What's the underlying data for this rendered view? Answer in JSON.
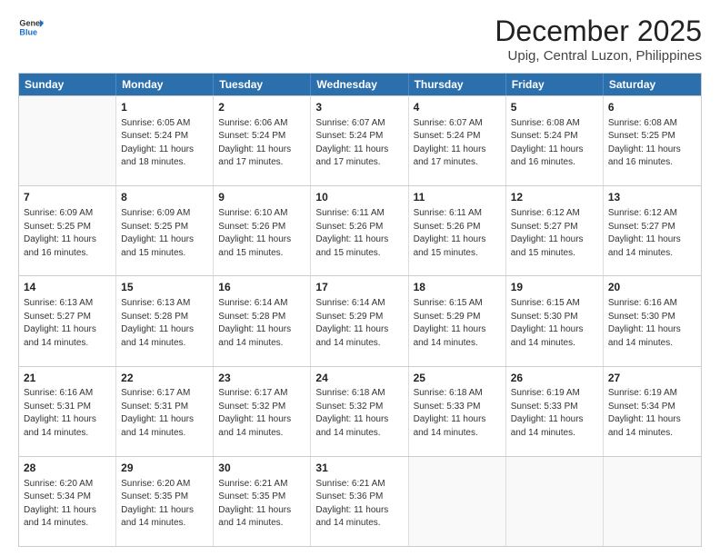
{
  "header": {
    "logo_general": "General",
    "logo_blue": "Blue",
    "title": "December 2025",
    "subtitle": "Upig, Central Luzon, Philippines"
  },
  "days": [
    "Sunday",
    "Monday",
    "Tuesday",
    "Wednesday",
    "Thursday",
    "Friday",
    "Saturday"
  ],
  "weeks": [
    [
      {
        "day": "",
        "empty": true
      },
      {
        "day": "1",
        "sunrise": "Sunrise: 6:05 AM",
        "sunset": "Sunset: 5:24 PM",
        "daylight": "Daylight: 11 hours and 18 minutes."
      },
      {
        "day": "2",
        "sunrise": "Sunrise: 6:06 AM",
        "sunset": "Sunset: 5:24 PM",
        "daylight": "Daylight: 11 hours and 17 minutes."
      },
      {
        "day": "3",
        "sunrise": "Sunrise: 6:07 AM",
        "sunset": "Sunset: 5:24 PM",
        "daylight": "Daylight: 11 hours and 17 minutes."
      },
      {
        "day": "4",
        "sunrise": "Sunrise: 6:07 AM",
        "sunset": "Sunset: 5:24 PM",
        "daylight": "Daylight: 11 hours and 17 minutes."
      },
      {
        "day": "5",
        "sunrise": "Sunrise: 6:08 AM",
        "sunset": "Sunset: 5:24 PM",
        "daylight": "Daylight: 11 hours and 16 minutes."
      },
      {
        "day": "6",
        "sunrise": "Sunrise: 6:08 AM",
        "sunset": "Sunset: 5:25 PM",
        "daylight": "Daylight: 11 hours and 16 minutes."
      }
    ],
    [
      {
        "day": "7",
        "sunrise": "Sunrise: 6:09 AM",
        "sunset": "Sunset: 5:25 PM",
        "daylight": "Daylight: 11 hours and 16 minutes."
      },
      {
        "day": "8",
        "sunrise": "Sunrise: 6:09 AM",
        "sunset": "Sunset: 5:25 PM",
        "daylight": "Daylight: 11 hours and 15 minutes."
      },
      {
        "day": "9",
        "sunrise": "Sunrise: 6:10 AM",
        "sunset": "Sunset: 5:26 PM",
        "daylight": "Daylight: 11 hours and 15 minutes."
      },
      {
        "day": "10",
        "sunrise": "Sunrise: 6:11 AM",
        "sunset": "Sunset: 5:26 PM",
        "daylight": "Daylight: 11 hours and 15 minutes."
      },
      {
        "day": "11",
        "sunrise": "Sunrise: 6:11 AM",
        "sunset": "Sunset: 5:26 PM",
        "daylight": "Daylight: 11 hours and 15 minutes."
      },
      {
        "day": "12",
        "sunrise": "Sunrise: 6:12 AM",
        "sunset": "Sunset: 5:27 PM",
        "daylight": "Daylight: 11 hours and 15 minutes."
      },
      {
        "day": "13",
        "sunrise": "Sunrise: 6:12 AM",
        "sunset": "Sunset: 5:27 PM",
        "daylight": "Daylight: 11 hours and 14 minutes."
      }
    ],
    [
      {
        "day": "14",
        "sunrise": "Sunrise: 6:13 AM",
        "sunset": "Sunset: 5:27 PM",
        "daylight": "Daylight: 11 hours and 14 minutes."
      },
      {
        "day": "15",
        "sunrise": "Sunrise: 6:13 AM",
        "sunset": "Sunset: 5:28 PM",
        "daylight": "Daylight: 11 hours and 14 minutes."
      },
      {
        "day": "16",
        "sunrise": "Sunrise: 6:14 AM",
        "sunset": "Sunset: 5:28 PM",
        "daylight": "Daylight: 11 hours and 14 minutes."
      },
      {
        "day": "17",
        "sunrise": "Sunrise: 6:14 AM",
        "sunset": "Sunset: 5:29 PM",
        "daylight": "Daylight: 11 hours and 14 minutes."
      },
      {
        "day": "18",
        "sunrise": "Sunrise: 6:15 AM",
        "sunset": "Sunset: 5:29 PM",
        "daylight": "Daylight: 11 hours and 14 minutes."
      },
      {
        "day": "19",
        "sunrise": "Sunrise: 6:15 AM",
        "sunset": "Sunset: 5:30 PM",
        "daylight": "Daylight: 11 hours and 14 minutes."
      },
      {
        "day": "20",
        "sunrise": "Sunrise: 6:16 AM",
        "sunset": "Sunset: 5:30 PM",
        "daylight": "Daylight: 11 hours and 14 minutes."
      }
    ],
    [
      {
        "day": "21",
        "sunrise": "Sunrise: 6:16 AM",
        "sunset": "Sunset: 5:31 PM",
        "daylight": "Daylight: 11 hours and 14 minutes."
      },
      {
        "day": "22",
        "sunrise": "Sunrise: 6:17 AM",
        "sunset": "Sunset: 5:31 PM",
        "daylight": "Daylight: 11 hours and 14 minutes."
      },
      {
        "day": "23",
        "sunrise": "Sunrise: 6:17 AM",
        "sunset": "Sunset: 5:32 PM",
        "daylight": "Daylight: 11 hours and 14 minutes."
      },
      {
        "day": "24",
        "sunrise": "Sunrise: 6:18 AM",
        "sunset": "Sunset: 5:32 PM",
        "daylight": "Daylight: 11 hours and 14 minutes."
      },
      {
        "day": "25",
        "sunrise": "Sunrise: 6:18 AM",
        "sunset": "Sunset: 5:33 PM",
        "daylight": "Daylight: 11 hours and 14 minutes."
      },
      {
        "day": "26",
        "sunrise": "Sunrise: 6:19 AM",
        "sunset": "Sunset: 5:33 PM",
        "daylight": "Daylight: 11 hours and 14 minutes."
      },
      {
        "day": "27",
        "sunrise": "Sunrise: 6:19 AM",
        "sunset": "Sunset: 5:34 PM",
        "daylight": "Daylight: 11 hours and 14 minutes."
      }
    ],
    [
      {
        "day": "28",
        "sunrise": "Sunrise: 6:20 AM",
        "sunset": "Sunset: 5:34 PM",
        "daylight": "Daylight: 11 hours and 14 minutes."
      },
      {
        "day": "29",
        "sunrise": "Sunrise: 6:20 AM",
        "sunset": "Sunset: 5:35 PM",
        "daylight": "Daylight: 11 hours and 14 minutes."
      },
      {
        "day": "30",
        "sunrise": "Sunrise: 6:21 AM",
        "sunset": "Sunset: 5:35 PM",
        "daylight": "Daylight: 11 hours and 14 minutes."
      },
      {
        "day": "31",
        "sunrise": "Sunrise: 6:21 AM",
        "sunset": "Sunset: 5:36 PM",
        "daylight": "Daylight: 11 hours and 14 minutes."
      },
      {
        "day": "",
        "empty": true
      },
      {
        "day": "",
        "empty": true
      },
      {
        "day": "",
        "empty": true
      }
    ]
  ]
}
